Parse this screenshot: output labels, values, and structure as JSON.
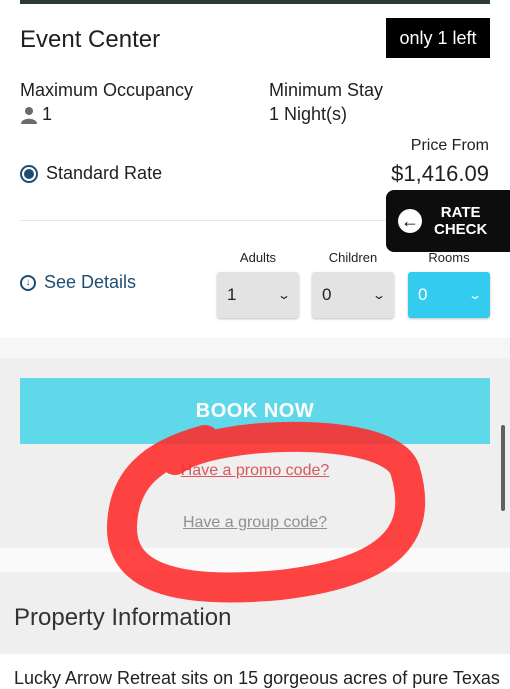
{
  "room": {
    "title": "Event Center",
    "availability_badge": "only 1 left",
    "max_occupancy_label": "Maximum Occupancy",
    "max_occupancy_value": "1",
    "min_stay_label": "Minimum Stay",
    "min_stay_value": "1 Night(s)",
    "rate_name": "Standard Rate",
    "price_from_label": "Price From",
    "price_value": "$1,416.09"
  },
  "rate_check": {
    "line1": "RATE",
    "line2": "CHECK"
  },
  "details": {
    "see_details_label": "See Details"
  },
  "selectors": {
    "adults_label": "Adults",
    "adults_value": "1",
    "children_label": "Children",
    "children_value": "0",
    "rooms_label": "Rooms",
    "rooms_value": "0"
  },
  "booking": {
    "book_now_label": "BOOK NOW",
    "promo_link": "Have a promo code?",
    "group_link": "Have a group code?"
  },
  "property": {
    "section_title": "Property Information",
    "description_start": "Lucky Arrow Retreat sits on 15 gorgeous acres of pure Texas"
  },
  "colors": {
    "brand_dark": "#1f4d72",
    "accent_cyan": "#33ccee",
    "book_button": "#5fd8ea",
    "annotation_red": "#ff2a2a"
  }
}
